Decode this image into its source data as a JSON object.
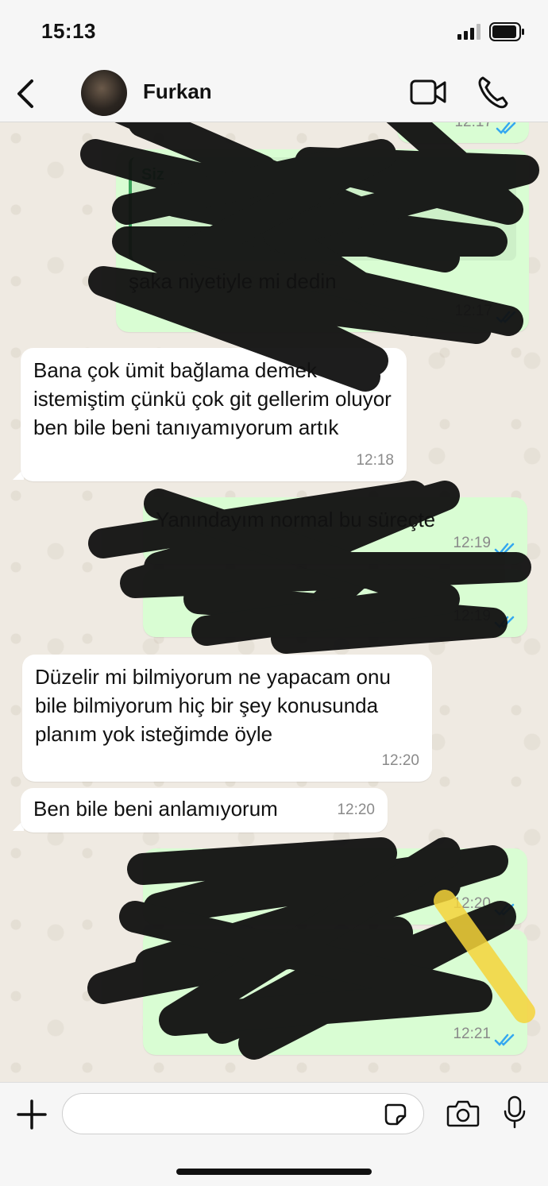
{
  "status_bar": {
    "time": "15:13"
  },
  "header": {
    "contact_name": "Furkan"
  },
  "messages": [
    {
      "direction": "out",
      "text": "",
      "time": "12:17"
    },
    {
      "direction": "out",
      "quote_author": "Siz",
      "quote_text": "",
      "text": "şaka niyetiyle mi dedin",
      "time": "12:17"
    },
    {
      "direction": "in",
      "text": "Bana çok ümit bağlama demek istemiştim çünkü çok git gellerim oluyor ben bile beni tanıyamıyorum artık",
      "time": "12:18"
    },
    {
      "direction": "out",
      "text": "Yanındayım normal bu süreçte",
      "time": "12:19"
    },
    {
      "direction": "out",
      "text": "",
      "time": "12:19"
    },
    {
      "direction": "in",
      "text": "Düzelir mi bilmiyorum ne yapacam onu bile bilmiyorum hiç bir şey konusunda planım yok isteğimde öyle",
      "time": "12:20"
    },
    {
      "direction": "in",
      "text": "Ben bile beni anlamıyorum",
      "time": "12:20"
    },
    {
      "direction": "out",
      "text": "",
      "time": "12:20"
    },
    {
      "direction": "out",
      "text": "",
      "time": "12:21"
    }
  ],
  "input": {
    "placeholder": ""
  },
  "colors": {
    "incoming_bubble": "#ffffff",
    "outgoing_bubble": "#d9fdd3",
    "read_ticks": "#34a7f0",
    "chat_background": "#efeae2",
    "scribble": "#111111"
  },
  "icons": {
    "back": "chevron-left-icon",
    "video": "video-camera-icon",
    "call": "phone-icon",
    "plus": "plus-icon",
    "sticker": "sticker-icon",
    "camera": "camera-icon",
    "mic": "microphone-icon"
  }
}
